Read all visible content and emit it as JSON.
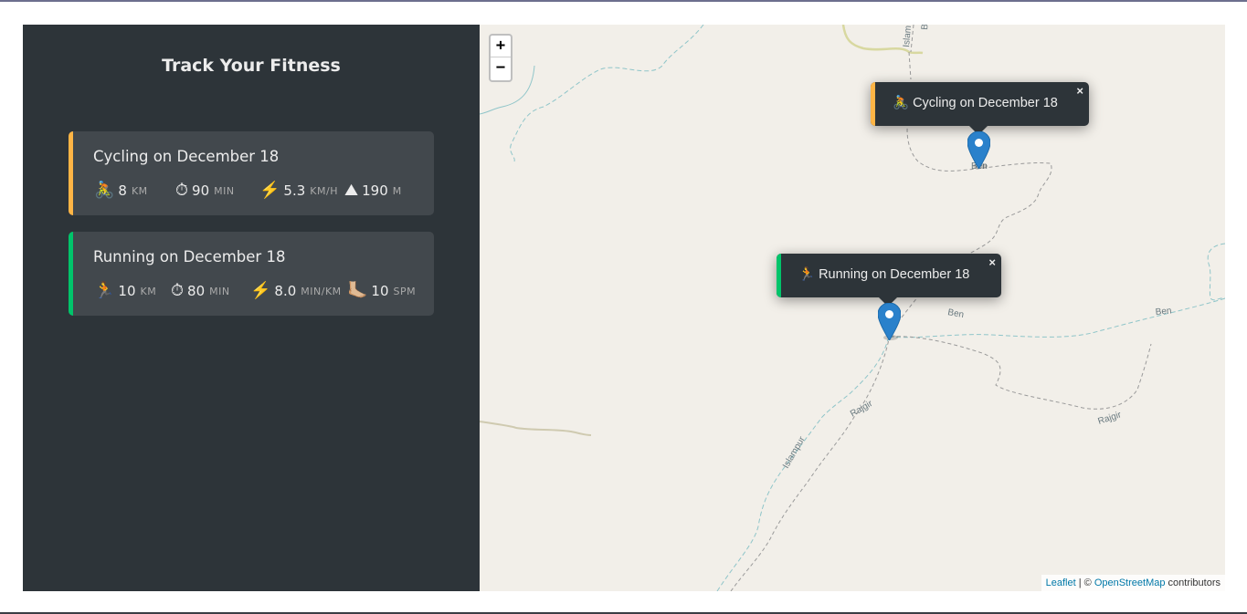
{
  "sidebar": {
    "title": "Track Your Fitness",
    "workouts": [
      {
        "title": "Cycling on December 18",
        "accent": "#ffb545",
        "details": [
          {
            "icon": "🚴",
            "value": "8",
            "unit": "km"
          },
          {
            "icon": "⏱",
            "value": "90",
            "unit": "min"
          },
          {
            "icon": "⚡️",
            "value": "5.3",
            "unit": "km/h"
          },
          {
            "icon": "⛰",
            "value": "190",
            "unit": "m"
          }
        ]
      },
      {
        "title": "Running on December 18",
        "accent": "#00c46a",
        "details": [
          {
            "icon": "🏃",
            "value": "10",
            "unit": "km"
          },
          {
            "icon": "⏱",
            "value": "80",
            "unit": "min"
          },
          {
            "icon": "⚡️",
            "value": "8.0",
            "unit": "min/km"
          },
          {
            "icon": "🦶🏼",
            "value": "10",
            "unit": "spm"
          }
        ]
      }
    ]
  },
  "map": {
    "zoom_in": "+",
    "zoom_out": "−",
    "popups": [
      {
        "text": "🚴 Cycling on December 18",
        "accent": "#ffb545",
        "close": "×"
      },
      {
        "text": "🏃 Running on December 18",
        "accent": "#00c46a",
        "close": "×"
      }
    ],
    "labels": {
      "ben1": "Ben",
      "ben2": "Ben",
      "ben3": "Ben",
      "rajgir1": "Rajgir",
      "rajgir2": "Rajgir",
      "islampur": "Islampur",
      "islam_top": "Islam",
      "b_top": "B"
    },
    "attribution": {
      "leaflet": "Leaflet",
      "separator": " | © ",
      "osm": "OpenStreetMap",
      "suffix": " contributors"
    },
    "marker_color": "#2a81cb"
  }
}
